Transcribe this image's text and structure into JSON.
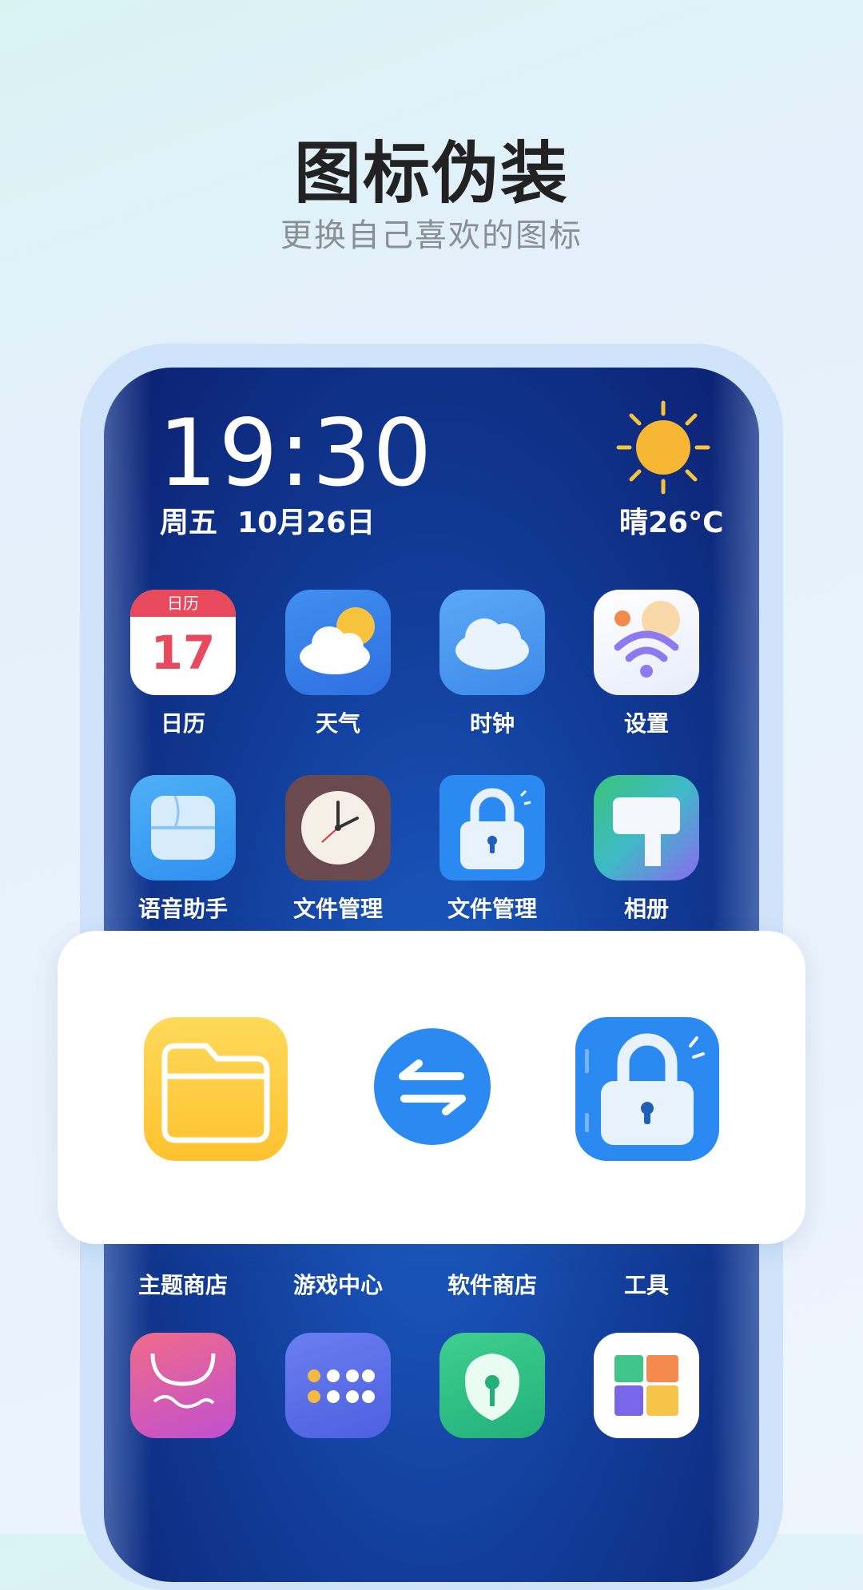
{
  "header": {
    "title": "图标伪装",
    "subtitle": "更换自己喜欢的图标"
  },
  "phone": {
    "time": "19:30",
    "date": "周五  10月26日",
    "weather": "晴26°C",
    "calendar_day": "17",
    "calendar_header": "日历",
    "rows": [
      [
        {
          "label": "日历",
          "icon": "calendar-icon"
        },
        {
          "label": "天气",
          "icon": "weather-icon"
        },
        {
          "label": "时钟",
          "icon": "cloud-icon"
        },
        {
          "label": "设置",
          "icon": "wifi-icon"
        }
      ],
      [
        {
          "label": "语音助手",
          "icon": "voice-assistant-icon"
        },
        {
          "label": "文件管理",
          "icon": "clock-icon"
        },
        {
          "label": "文件管理",
          "icon": "lock-icon"
        },
        {
          "label": "相册",
          "icon": "gallery-icon"
        }
      ],
      [
        {
          "label": "主题商店"
        },
        {
          "label": "游戏中心"
        },
        {
          "label": "软件商店"
        },
        {
          "label": "工具"
        }
      ],
      [
        {
          "icon": "shopping-icon"
        },
        {
          "icon": "dots-grid-icon"
        },
        {
          "icon": "shield-icon"
        },
        {
          "icon": "tiles-icon"
        }
      ]
    ]
  },
  "swap_card": {
    "from_icon": "folder-icon",
    "action_icon": "swap-arrows-icon",
    "to_icon": "lock-icon"
  },
  "colors": {
    "accent": "#2a8af2",
    "folder": "#ffc93c",
    "title": "#222222",
    "subtitle": "#8a8f95"
  }
}
